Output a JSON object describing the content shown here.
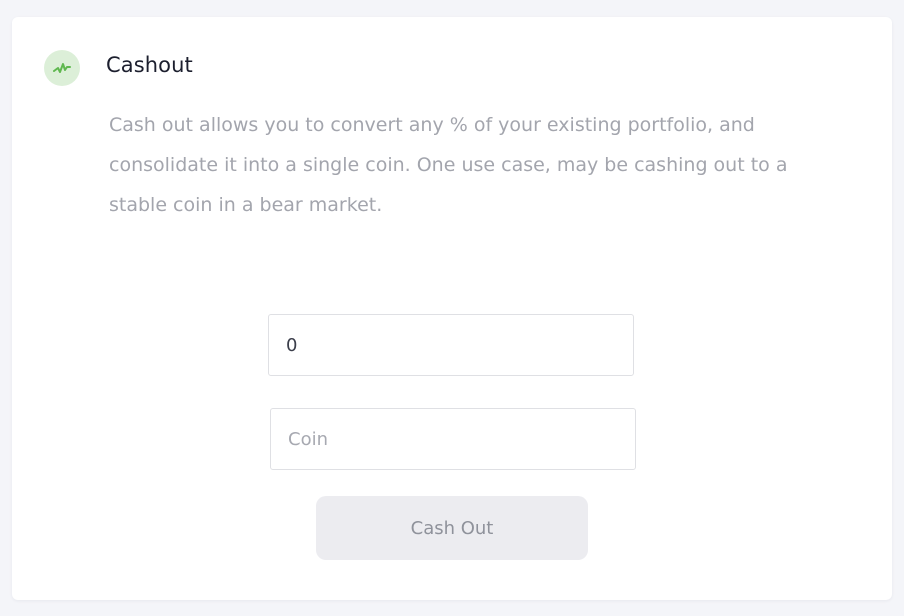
{
  "card": {
    "icon": "activity-chart-icon",
    "title": "Cashout",
    "description": "Cash out allows you to convert any % of your existing portfolio, and consolidate it into a single coin. One use case, may be cashing out to a stable coin in a bear market."
  },
  "form": {
    "amount_value": "0",
    "coin_value": "",
    "coin_placeholder": "Coin",
    "submit_label": "Cash Out"
  },
  "colors": {
    "icon_background": "#dcefd8",
    "icon_stroke": "#5fb84f",
    "button_background": "#ececf0",
    "button_text": "#8f929b"
  }
}
